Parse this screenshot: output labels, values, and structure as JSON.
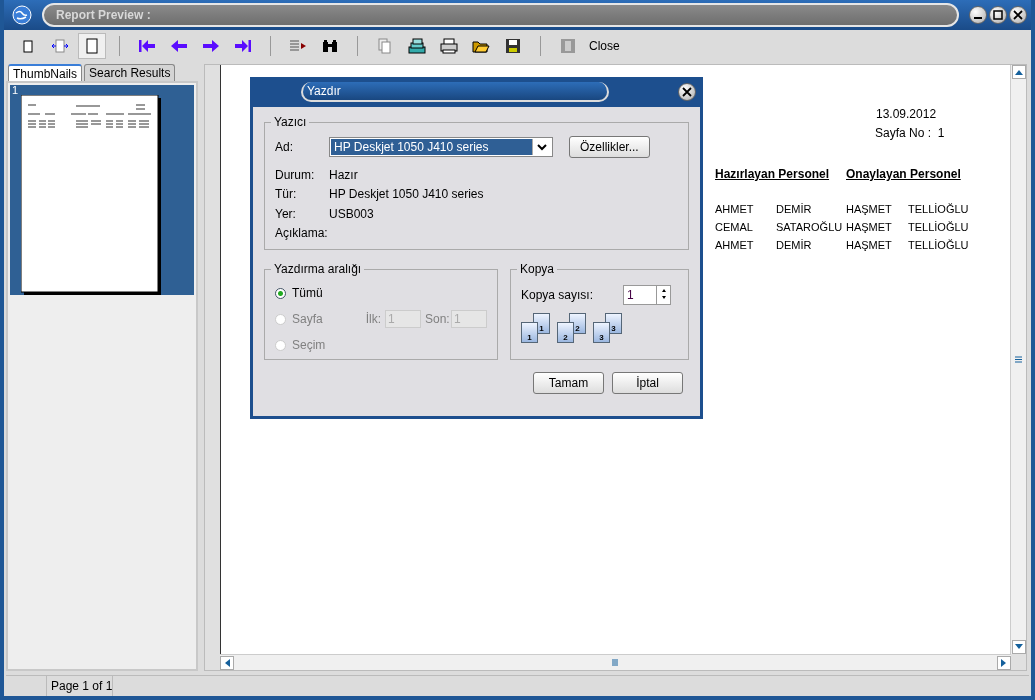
{
  "window": {
    "title": "Report Preview :"
  },
  "toolbar": {
    "view_modes": [
      {
        "selected": false
      },
      {
        "selected": false
      },
      {
        "selected": true
      }
    ],
    "close_label": "Close"
  },
  "side_tabs": [
    {
      "label": "ThumbNails",
      "selected": true
    },
    {
      "label": "Search Results",
      "selected": false
    }
  ],
  "thumbnail": {
    "page_number": "1",
    "selected": true
  },
  "report": {
    "date": "13.09.2012",
    "page_label": "Sayfa No :  1",
    "headings": [
      "Hazırlayan Personel",
      "Onaylayan Personel"
    ],
    "rows": [
      [
        "AHMET",
        "DEMİR",
        "HAŞMET",
        "TELLİOĞLU"
      ],
      [
        "CEMAL",
        "SATAROĞLU",
        "HAŞMET",
        "TELLİOĞLU"
      ],
      [
        "AHMET",
        "DEMİR",
        "HAŞMET",
        "TELLİOĞLU"
      ]
    ]
  },
  "dialog": {
    "title": "Yazdır",
    "printer_group": "Yazıcı",
    "name_label": "Ad:",
    "name_value": "HP Deskjet 1050 J410 series",
    "properties_button": "Özellikler...",
    "info": [
      {
        "label": "Durum:",
        "value": "Hazır"
      },
      {
        "label": "Tür:",
        "value": "HP Deskjet 1050 J410 series"
      },
      {
        "label": "Yer:",
        "value": "USB003"
      },
      {
        "label": "Açıklama:"
      }
    ],
    "range_group": "Yazdırma aralığı",
    "range_options": [
      {
        "label": "Tümü",
        "selected": true,
        "disabled": false
      },
      {
        "label": "Sayfa",
        "selected": false,
        "disabled": true
      },
      {
        "label": "Seçim",
        "selected": false,
        "disabled": true
      }
    ],
    "from_label": "İlk:",
    "from_value": "1",
    "to_label": "Son:",
    "to_value": "1",
    "page_fields_disabled": true,
    "copies_group": "Kopya",
    "copies_label": "Kopya sayısı:",
    "copies_value": "1",
    "collate_sets": [
      {
        "back": "1",
        "front": "1"
      },
      {
        "back": "2",
        "front": "2"
      },
      {
        "back": "3",
        "front": "3"
      }
    ],
    "buttons": [
      "Tamam",
      "İptal"
    ]
  },
  "status_bar": {
    "page": "Page 1 of 1"
  }
}
